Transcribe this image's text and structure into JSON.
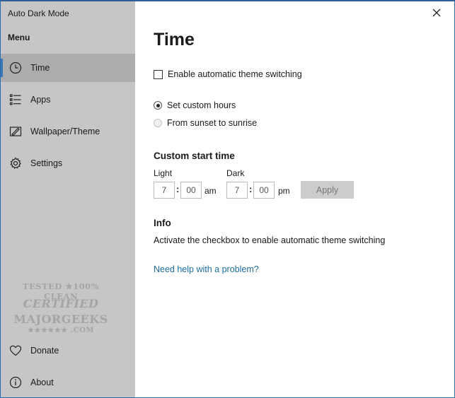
{
  "app": {
    "title": "Auto Dark Mode"
  },
  "sidebar": {
    "menu_header": "Menu",
    "items": [
      {
        "label": "Time",
        "icon": "clock-icon",
        "active": true
      },
      {
        "label": "Apps",
        "icon": "list-icon"
      },
      {
        "label": "Wallpaper/Theme",
        "icon": "brush-icon"
      },
      {
        "label": "Settings",
        "icon": "gear-icon"
      }
    ],
    "bottom_items": [
      {
        "label": "Donate",
        "icon": "heart-icon"
      },
      {
        "label": "About",
        "icon": "info-icon"
      }
    ],
    "watermark": {
      "line1": "TESTED ★100% CLEAN",
      "line2": "CERTIFIED",
      "line3": "MAJORGEEKS",
      "line4": "★★★★★★ .COM"
    }
  },
  "main": {
    "title": "Time",
    "enable_checkbox_label": "Enable automatic theme switching",
    "radio_custom_hours": "Set custom hours",
    "radio_sunset": "From sunset to sunrise",
    "custom_start_title": "Custom start time",
    "light_label": "Light",
    "dark_label": "Dark",
    "light_hour": "7",
    "light_minute": "00",
    "light_ampm": "am",
    "dark_hour": "7",
    "dark_minute": "00",
    "dark_ampm": "pm",
    "colon": ":",
    "apply_label": "Apply",
    "info_title": "Info",
    "info_text": "Activate the checkbox to enable automatic theme switching",
    "help_link": "Need help with a problem?"
  },
  "colors": {
    "sidebar_bg": "#c6c6c6",
    "active_item_bg": "#acacac",
    "accent": "#3c78b4",
    "link": "#1b6c9a",
    "apply_disabled_bg": "#cccccc"
  }
}
